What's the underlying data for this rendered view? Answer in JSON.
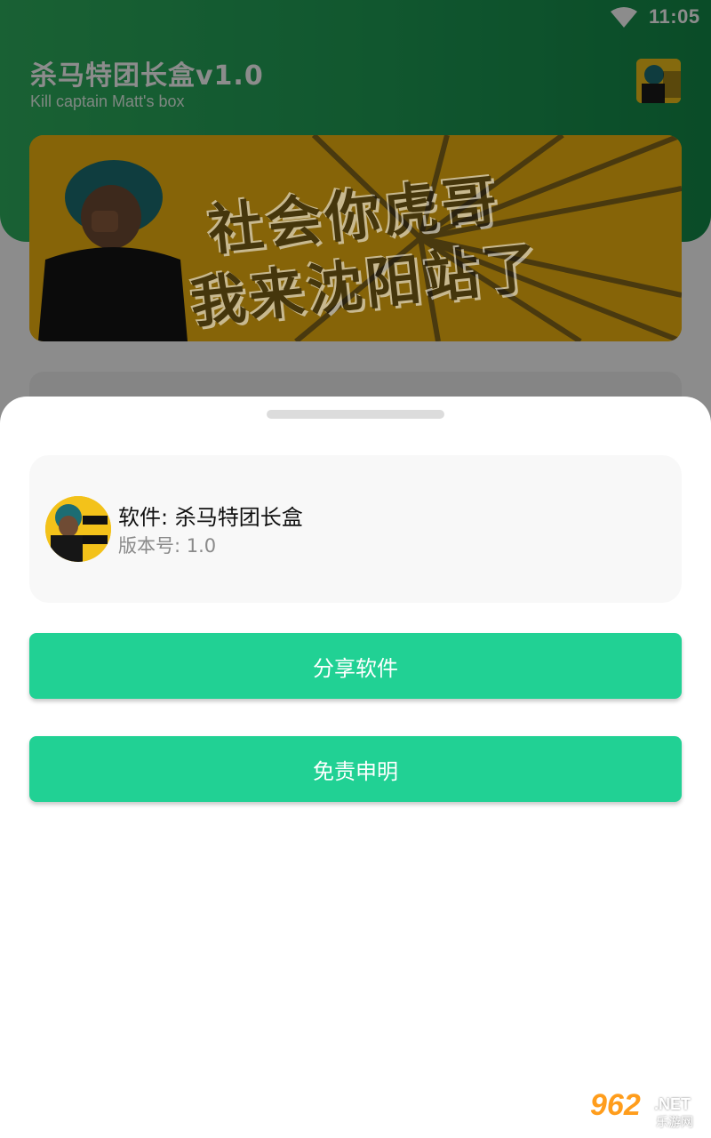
{
  "status_bar": {
    "time": "11:05"
  },
  "header": {
    "title": "杀马特团长盒v1.0",
    "subtitle": "Kill captain Matt's box"
  },
  "banner": {
    "line1": "社会你虎哥",
    "line2": "我来沈阳站了"
  },
  "sheet": {
    "app_name": "软件: 杀马特团长盒",
    "version": "版本号: 1.0",
    "share_button": "分享软件",
    "disclaimer_button": "免责申明"
  },
  "watermark": {
    "brand": "962",
    "domain": ".NET",
    "site": "乐游网"
  },
  "colors": {
    "header_green": "#1f9e56",
    "button_green": "#21d194",
    "banner_yellow": "#f5b70f"
  },
  "icons": [
    "wifi-icon"
  ]
}
